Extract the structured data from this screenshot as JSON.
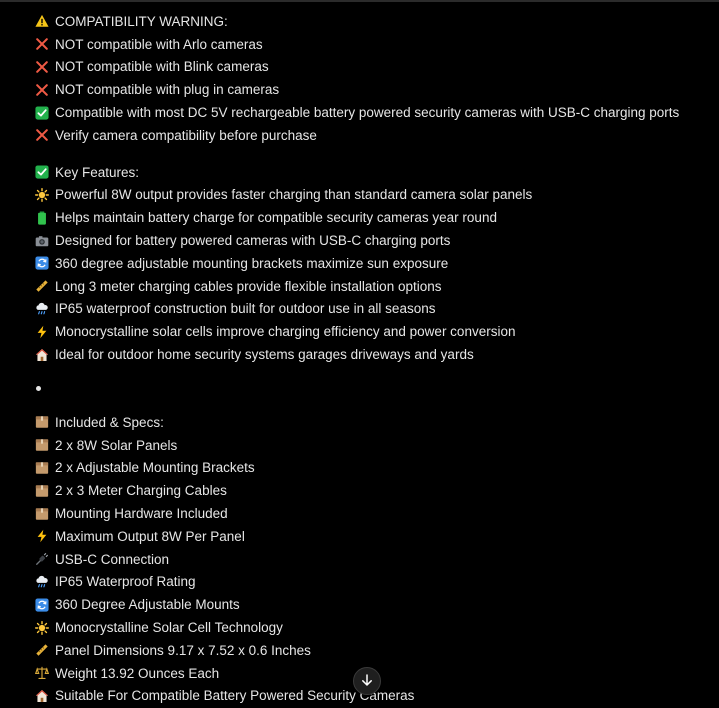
{
  "warning": {
    "heading": "COMPATIBILITY WARNING:",
    "items": [
      "NOT compatible with Arlo cameras",
      "NOT compatible with Blink cameras",
      "NOT compatible with plug in cameras",
      "Compatible with most DC 5V rechargeable battery powered security cameras with USB-C charging ports",
      "Verify camera compatibility before purchase"
    ]
  },
  "features": {
    "heading": "Key Features:",
    "items": [
      "Powerful 8W output provides faster charging than standard camera solar panels",
      "Helps maintain battery charge for compatible security cameras year round",
      "Designed for battery powered cameras with USB-C charging ports",
      "360 degree adjustable mounting brackets maximize sun exposure",
      "Long 3 meter charging cables provide flexible installation options",
      "IP65 waterproof construction built for outdoor use in all seasons",
      "Monocrystalline solar cells improve charging efficiency and power conversion",
      "Ideal for outdoor home security systems garages driveways and yards"
    ]
  },
  "specs": {
    "heading": "Included & Specs:",
    "items": [
      "2 x 8W Solar Panels",
      "2 x Adjustable Mounting Brackets",
      "2 x 3 Meter Charging Cables",
      "Mounting Hardware Included",
      "Maximum Output 8W Per Panel",
      "USB-C Connection",
      "IP65 Waterproof Rating",
      "360 Degree Adjustable Mounts",
      "Monocrystalline Solar Cell Technology",
      "Panel Dimensions 9.17 x 7.52 x 0.6 Inches",
      "Weight 13.92 Ounces Each",
      "Suitable For Compatible Battery Powered Security Cameras"
    ]
  },
  "icons": {
    "warning": "warning-icon",
    "warning_items": [
      "cross-mark-icon",
      "cross-mark-icon",
      "cross-mark-icon",
      "check-mark-icon",
      "cross-mark-icon"
    ],
    "features_heading": "check-mark-icon",
    "features_items": [
      "sun-icon",
      "battery-icon",
      "camera-icon",
      "rotate-icon",
      "ruler-icon",
      "rain-cloud-icon",
      "lightning-icon",
      "house-icon"
    ],
    "specs_heading": "package-icon",
    "specs_items": [
      "package-icon",
      "package-icon",
      "package-icon",
      "package-icon",
      "lightning-icon",
      "plug-icon",
      "rain-cloud-icon",
      "rotate-icon",
      "sun-icon",
      "ruler-icon",
      "scale-icon",
      "house-icon"
    ]
  },
  "colors": {
    "background": "#000000",
    "text": "#e6e6e6",
    "cross": "#f05a45",
    "check": "#22b14c",
    "warning": "#f5c518",
    "sun": "#ffc83d",
    "package": "#c49a6c",
    "rotate": "#3b8ce8"
  },
  "scroll_button": "scroll-down-arrow-icon"
}
